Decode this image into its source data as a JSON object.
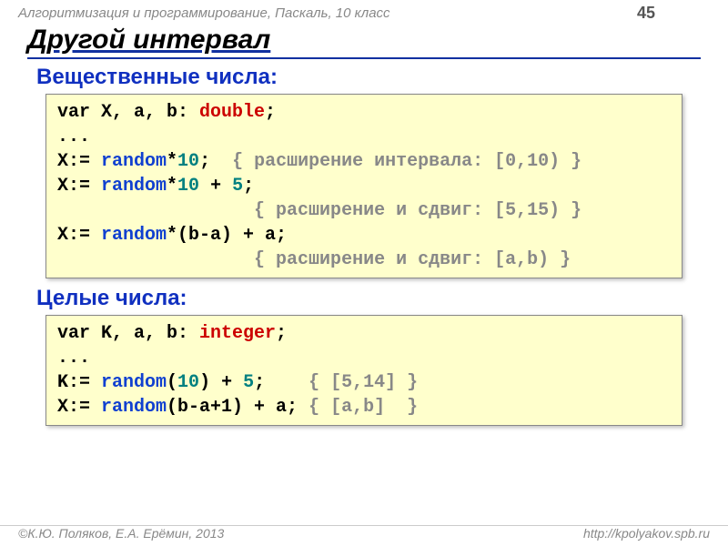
{
  "header": {
    "course": "Алгоритмизация и программирование, Паскаль, 10 класс",
    "page": "45"
  },
  "title": "Другой интервал",
  "sections": {
    "real": {
      "label": "Вещественные числа:",
      "code": {
        "l1a": "var X, a, b: ",
        "l1b": "double",
        "l1c": ";",
        "l2": "...",
        "l3a": "X:= ",
        "l3b": "random",
        "l3c": "*",
        "l3d": "10",
        "l3e": ";",
        "l3cmt": "  { расширение интервала: [0,10) }",
        "l4a": "X:= ",
        "l4b": "random",
        "l4c": "*",
        "l4d": "10",
        "l4e": " + ",
        "l4f": "5",
        "l4g": ";",
        "l5pad": "                  ",
        "l5cmt": "{ расширение и сдвиг: [5,15) }",
        "l6a": "X:= ",
        "l6b": "random",
        "l6c": "*(b-a) + a;",
        "l7pad": "                  ",
        "l7cmt": "{ расширение и сдвиг: [a,b) }"
      }
    },
    "int": {
      "label": "Целые числа:",
      "code": {
        "l1a": "var K, a, b: ",
        "l1b": "integer",
        "l1c": ";",
        "l2": "...",
        "l3a": "K:= ",
        "l3b": "random",
        "l3c": "(",
        "l3d": "10",
        "l3e": ") + ",
        "l3f": "5",
        "l3g": ";    ",
        "l3cmt": "{ [5,14] }",
        "l4a": "X:= ",
        "l4b": "random",
        "l4c": "(b-a+1) + a; ",
        "l4cmt": "{ [a,b]  }"
      }
    }
  },
  "footer": {
    "left": "©К.Ю. Поляков, Е.А. Ерёмин, 2013",
    "right": "http://kpolyakov.spb.ru"
  }
}
